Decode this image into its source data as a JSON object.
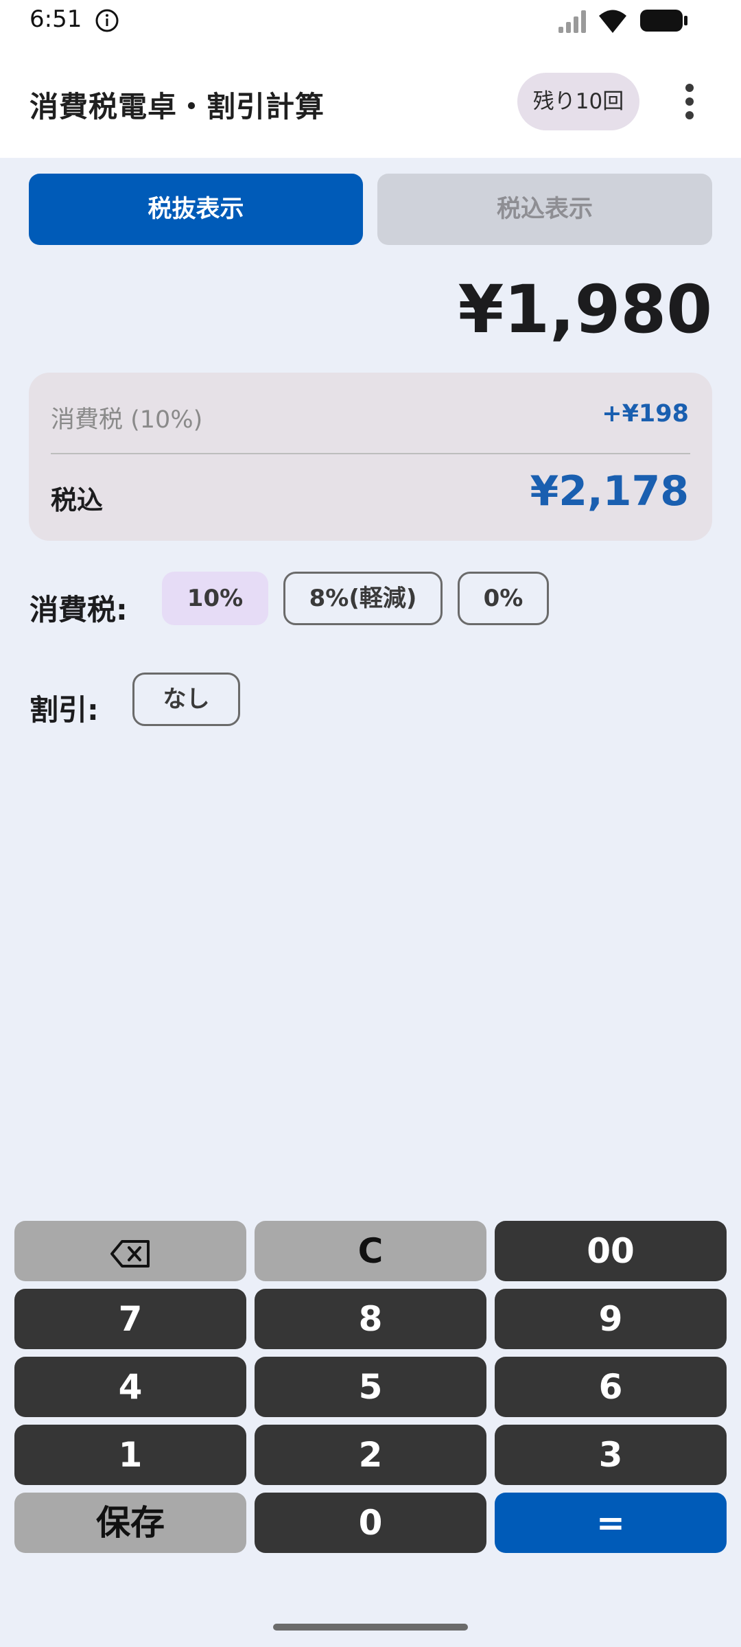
{
  "status_bar": {
    "time": "6:51"
  },
  "app_bar": {
    "title": "消費税電卓・割引計算",
    "remaining": "残り10回"
  },
  "display_toggle": {
    "excl_label": "税抜表示",
    "incl_label": "税込表示",
    "selected": "税抜表示"
  },
  "amount": "¥1,980",
  "tax_card": {
    "tax_label": "消費税 (10%)",
    "tax_amount": "+¥198",
    "incl_label": "税込",
    "incl_amount": "¥2,178"
  },
  "tax_rate": {
    "label": "消費税:",
    "options": [
      "10%",
      "8%(軽減)",
      "0%"
    ],
    "selected": "10%"
  },
  "discount": {
    "label": "割引:",
    "value": "なし"
  },
  "keypad": {
    "backspace_icon": "backspace-icon",
    "clear": "C",
    "double_zero": "00",
    "k7": "7",
    "k8": "8",
    "k9": "9",
    "k4": "4",
    "k5": "5",
    "k6": "6",
    "k1": "1",
    "k2": "2",
    "k3": "3",
    "save": "保存",
    "k0": "0",
    "equals": "="
  },
  "colors": {
    "accent": "#005bb8",
    "background": "#ebeff8",
    "key_dark": "#363636",
    "key_light": "#a9a9a9",
    "chip_selected": "#e6dcf6"
  }
}
